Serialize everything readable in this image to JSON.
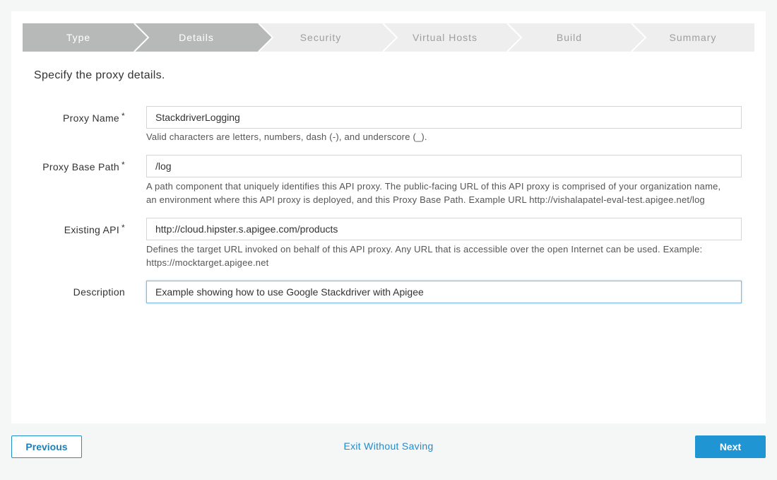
{
  "wizard": {
    "steps": [
      {
        "label": "Type",
        "state": "done"
      },
      {
        "label": "Details",
        "state": "current"
      },
      {
        "label": "Security",
        "state": "todo"
      },
      {
        "label": "Virtual Hosts",
        "state": "todo"
      },
      {
        "label": "Build",
        "state": "todo"
      },
      {
        "label": "Summary",
        "state": "todo"
      }
    ]
  },
  "intro": "Specify the proxy details.",
  "required_marker": "*",
  "form": {
    "proxy_name": {
      "label": "Proxy Name",
      "value": "StackdriverLogging",
      "help": "Valid characters are letters, numbers, dash (-), and underscore (_)."
    },
    "base_path": {
      "label": "Proxy Base Path",
      "value": "/log",
      "help_line1": "A path component that uniquely identifies this API proxy. The public-facing URL of this API proxy is comprised of your organization name,",
      "help_line2": "an environment where this API proxy is deployed, and this Proxy Base Path. Example URL http://vishalapatel-eval-test.apigee.net/log"
    },
    "existing_api": {
      "label": "Existing API",
      "value": "http://cloud.hipster.s.apigee.com/products",
      "help_line1": "Defines the target URL invoked on behalf of this API proxy. Any URL that is accessible over the open Internet can be used. Example:",
      "help_line2": "https://mocktarget.apigee.net"
    },
    "description": {
      "label": "Description",
      "value": "Example showing how to use Google Stackdriver with Apigee"
    }
  },
  "footer": {
    "previous_label": "Previous",
    "exit_label": "Exit Without Saving",
    "next_label": "Next"
  },
  "colors": {
    "accent": "#1f95d3",
    "step_done": "#b7b8b8",
    "step_todo": "#eeeeee"
  }
}
